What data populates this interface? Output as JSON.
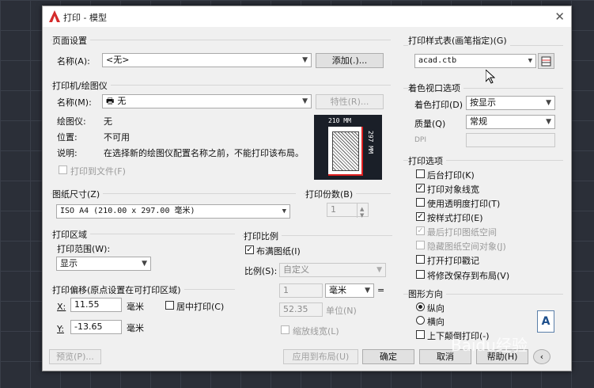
{
  "window": {
    "title": "打印 - 模型",
    "close_glyph": "✕"
  },
  "page_setup": {
    "group_title": "页面设置",
    "name_label": "名称(A):",
    "name_value": "<无>",
    "add_button": "添加(.)..."
  },
  "printer": {
    "group_title": "打印机/绘图仪",
    "name_label": "名称(M):",
    "name_value": "无",
    "properties_button": "特性(R)...",
    "plotter_label": "绘图仪:",
    "plotter_value": "无",
    "location_label": "位置:",
    "location_value": "不可用",
    "desc_label": "说明:",
    "desc_value": "在选择新的绘图仪配置名称之前，不能打印该布局。",
    "print_to_file": "打印到文件(F)",
    "preview_width": "210 MM",
    "preview_height": "297 MM"
  },
  "paper_size": {
    "group_title": "图纸尺寸(Z)",
    "value": "ISO A4 (210.00 x 297.00 毫米)"
  },
  "copies": {
    "group_title": "打印份数(B)",
    "value": "1"
  },
  "plot_area": {
    "group_title": "打印区域",
    "range_label": "打印范围(W):",
    "range_value": "显示"
  },
  "plot_offset": {
    "group_title": "打印偏移(原点设置在可打印区域)",
    "x_label": "X:",
    "x_value": "11.55",
    "x_unit": "毫米",
    "y_label": "Y:",
    "y_value": "-13.65",
    "y_unit": "毫米",
    "center_label": "居中打印(C)"
  },
  "plot_scale": {
    "group_title": "打印比例",
    "fit_label": "布满图纸(I)",
    "scale_label": "比例(S):",
    "scale_value": "自定义",
    "num_value": "1",
    "unit_value": "毫米",
    "equals": "=",
    "unit2_value": "52.35",
    "unit2_label": "单位(N)",
    "lineweights_label": "缩放线宽(L)"
  },
  "plot_style_table": {
    "group_title": "打印样式表(画笔指定)(G)",
    "value": "acad.ctb"
  },
  "shaded_viewport": {
    "group_title": "着色视口选项",
    "shade_label": "着色打印(D)",
    "shade_value": "按显示",
    "quality_label": "质量(Q)",
    "quality_value": "常规",
    "dpi_label": "DPI"
  },
  "plot_options": {
    "group_title": "打印选项",
    "items": [
      {
        "label": "后台打印(K)",
        "checked": "",
        "disabled": false
      },
      {
        "label": "打印对象线宽",
        "checked": "✓",
        "disabled": false
      },
      {
        "label": "使用透明度打印(T)",
        "checked": "",
        "disabled": false
      },
      {
        "label": "按样式打印(E)",
        "checked": "✓",
        "disabled": false
      },
      {
        "label": "最后打印图纸空间",
        "checked": "✓",
        "disabled": true
      },
      {
        "label": "隐藏图纸空间对象(J)",
        "checked": "",
        "disabled": true
      },
      {
        "label": "打开打印戳记",
        "checked": "",
        "disabled": false
      },
      {
        "label": "将修改保存到布局(V)",
        "checked": "",
        "disabled": false
      }
    ]
  },
  "orientation": {
    "group_title": "图形方向",
    "portrait": "纵向",
    "landscape": "横向",
    "upside_down": "上下颠倒打印(-)",
    "icon_letter": "A"
  },
  "footer": {
    "preview_button": "预览(P)...",
    "apply_button": "应用到布局(U)",
    "ok_button": "确定",
    "cancel_button": "取消",
    "help_button": "帮助(H)"
  },
  "watermark": "Baidu经验",
  "colors": {
    "accent_red": "#e02020",
    "dialog_bg": "#f0f0f0",
    "preview_bg": "#1a1f28"
  }
}
